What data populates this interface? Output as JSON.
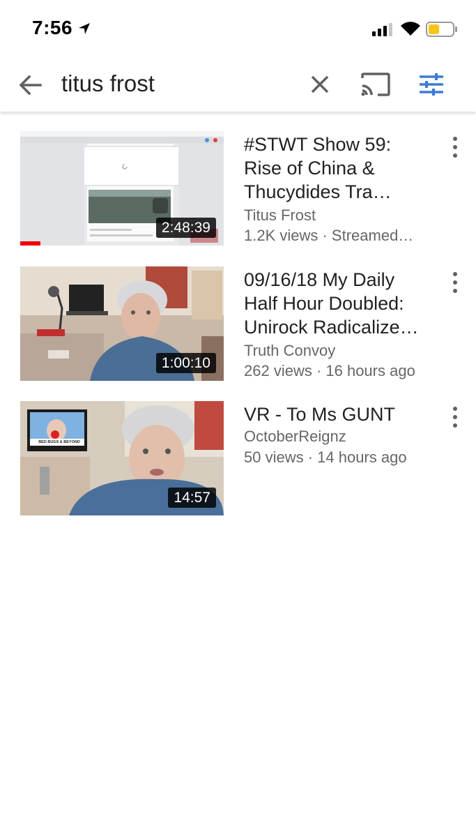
{
  "status_bar": {
    "time": "7:56",
    "battery_color": "#f5c518"
  },
  "search": {
    "query": "titus frost",
    "accent_color": "#3f7bd6"
  },
  "results": [
    {
      "title": "#STWT Show 59: Rise of China & Thucydides Tra…",
      "channel": "Titus Frost",
      "meta": "1.2K views · Streamed…",
      "duration": "2:48:39",
      "watched_fraction": 0.1
    },
    {
      "title": "09/16/18 My Daily Half Hour Doubled: Unirock Radicalize…",
      "channel": "Truth Convoy",
      "meta": "262 views · 16 hours ago",
      "duration": "1:00:10"
    },
    {
      "title": "VR - To Ms  GUNT",
      "channel": "OctoberReignz",
      "meta": "50 views · 14 hours ago",
      "duration": "14:57",
      "thumbnail_caption": "BED BUGS & BEYOND"
    }
  ]
}
